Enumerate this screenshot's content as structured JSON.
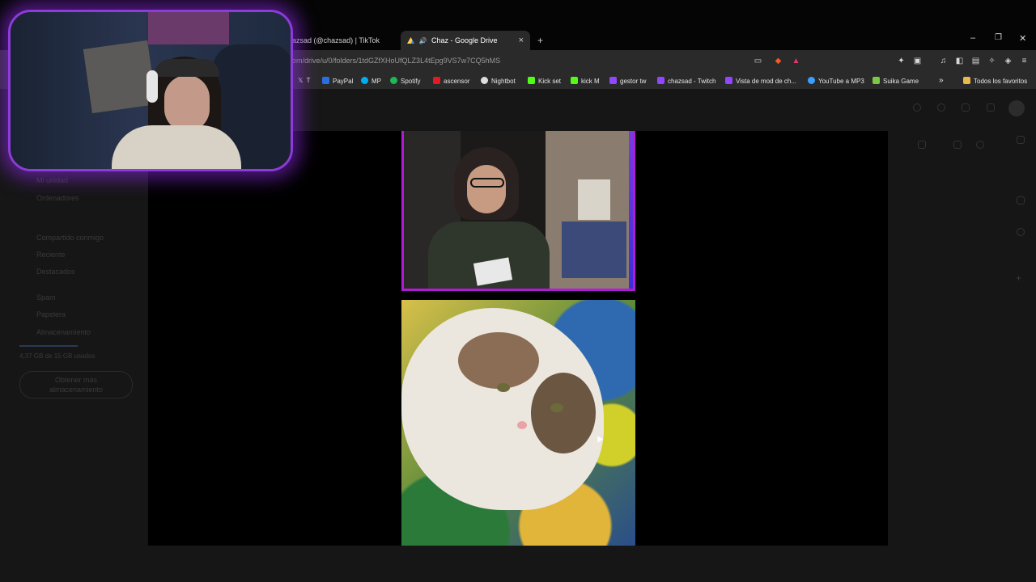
{
  "browser": {
    "tabs": [
      {
        "title": "hazsad (@chazsad) | TikTok",
        "active": false
      },
      {
        "title": "Chaz - Google Drive",
        "active": true
      }
    ],
    "new_tab_label": "+",
    "tab_close_label": "×",
    "url": "om/drive/u/0/folders/1tdGZfXHoUfQLZ3L4tEpg9VS7w7CQ5hMS",
    "window_controls": {
      "minimize": "–",
      "restore": "❐",
      "close": "✕"
    }
  },
  "bookmarks": [
    {
      "label": "T",
      "color": "#000000",
      "icon": "x-icon"
    },
    {
      "label": "PayPal",
      "color": "#2a6fdb",
      "icon": "paypal-icon"
    },
    {
      "label": "MP",
      "color": "#00aeef",
      "icon": "mercadopago-icon"
    },
    {
      "label": "Spotify",
      "color": "#1db954",
      "icon": "spotify-icon"
    },
    {
      "label": "ascensor",
      "color": "#e01b24",
      "icon": "youtube-icon"
    },
    {
      "label": "Nightbot",
      "color": "#dddddd",
      "icon": "nightbot-icon"
    },
    {
      "label": "Kick set",
      "color": "#53fc18",
      "icon": "kick-icon"
    },
    {
      "label": "kick M",
      "color": "#53fc18",
      "icon": "kick-icon"
    },
    {
      "label": "gestor tw",
      "color": "#9146ff",
      "icon": "twitch-icon"
    },
    {
      "label": "chazsad - Twitch",
      "color": "#9146ff",
      "icon": "twitch-icon"
    },
    {
      "label": "Vista de mod de ch...",
      "color": "#9146ff",
      "icon": "twitch-icon"
    },
    {
      "label": "YouTube a MP3",
      "color": "#3aa0ff",
      "icon": "download-icon"
    },
    {
      "label": "Suika Game",
      "color": "#7ac943",
      "icon": "suika-icon"
    }
  ],
  "bookmarks_overflow": "»",
  "all_bookmarks": "Todos los favoritos",
  "drive_sidebar_ghost": [
    "Mi unidad",
    "Ordenadores",
    "Compartido conmigo",
    "Reciente",
    "Destacados",
    "Spam",
    "Papelera",
    "Almacenamiento",
    "4,37 GB de 15 GB usados",
    "Obtener más",
    "almacenamiento"
  ],
  "colors": {
    "accent_purple": "#b11ad6",
    "chrome_bg": "#2a2a2a"
  }
}
